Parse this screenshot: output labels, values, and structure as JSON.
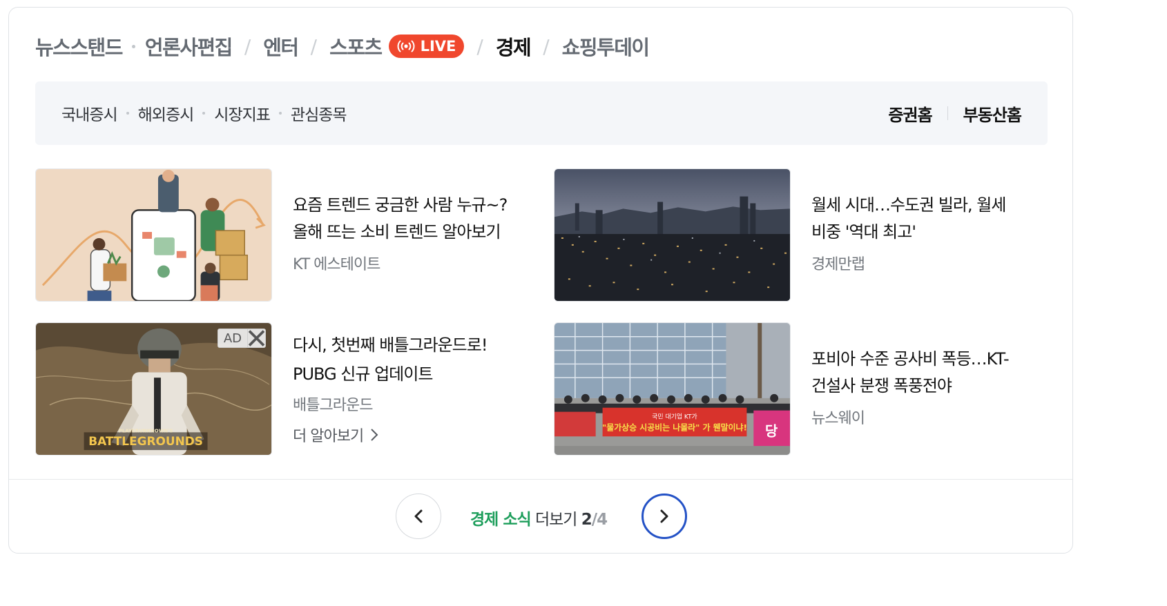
{
  "tabs": {
    "newsstand": "뉴스스탠드",
    "press_edit": "언론사편집",
    "enter": "엔터",
    "sports": "스포츠",
    "live_badge": "LIVE",
    "economy": "경제",
    "shopping": "쇼핑투데이"
  },
  "subnav": {
    "left": [
      "국내증시",
      "해외증시",
      "시장지표",
      "관심종목"
    ],
    "right": [
      "증권홈",
      "부동산홈"
    ]
  },
  "articles": [
    {
      "title": "요즘 트렌드 궁금한 사람 누규~? 올해 뜨는 소비 트렌드 알아보기",
      "source": "KT 에스테이트",
      "thumb_icon": "shopping-trend-illustration"
    },
    {
      "title": "월세 시대…수도권 빌라, 월세 비중 '역대 최고'",
      "source": "경제만랩",
      "thumb_icon": "city-night-photo"
    },
    {
      "title": "다시, 첫번째 배틀그라운드로! PUBG 신규 업데이트",
      "source": "배틀그라운드",
      "more": "더 알아보기",
      "ad_label": "AD",
      "thumb_icon": "battlegrounds-ad-image"
    },
    {
      "title": "포비아 수준 공사비 폭등…KT-건설사 분쟁 폭풍전야",
      "source": "뉴스웨이",
      "thumb_icon": "protest-photo"
    }
  ],
  "pagination": {
    "topic": "경제 소식",
    "more": "더보기",
    "current": "2",
    "total": "/4"
  },
  "colors": {
    "live": "#f0472d",
    "accent_green": "#1d9e5b",
    "next_ring": "#2452c6"
  }
}
